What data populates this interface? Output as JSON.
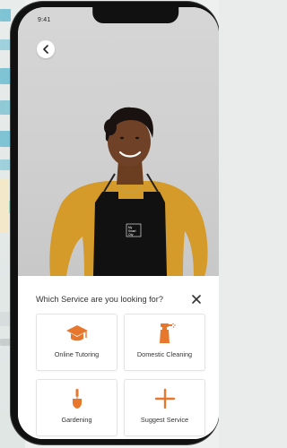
{
  "status_bar": {
    "time": "9:41"
  },
  "hero": {
    "apron_text": "My\nSmart\nCity"
  },
  "sheet": {
    "title": "Which Service are you looking for?",
    "services": [
      {
        "label": "Online Tutoring",
        "icon": "graduation-cap-icon"
      },
      {
        "label": "Domestic Cleaning",
        "icon": "spray-bottle-icon"
      },
      {
        "label": "Gardening",
        "icon": "trowel-icon"
      },
      {
        "label": "Suggest Service",
        "icon": "plus-icon"
      }
    ]
  },
  "colors": {
    "accent": "#e8772e",
    "sheet_background": "#ffffff",
    "tile_border": "#e3e3e3",
    "text": "#333333",
    "hero_background": "#d2d2d2",
    "shirt": "#d49a2a",
    "apron": "#111111"
  }
}
